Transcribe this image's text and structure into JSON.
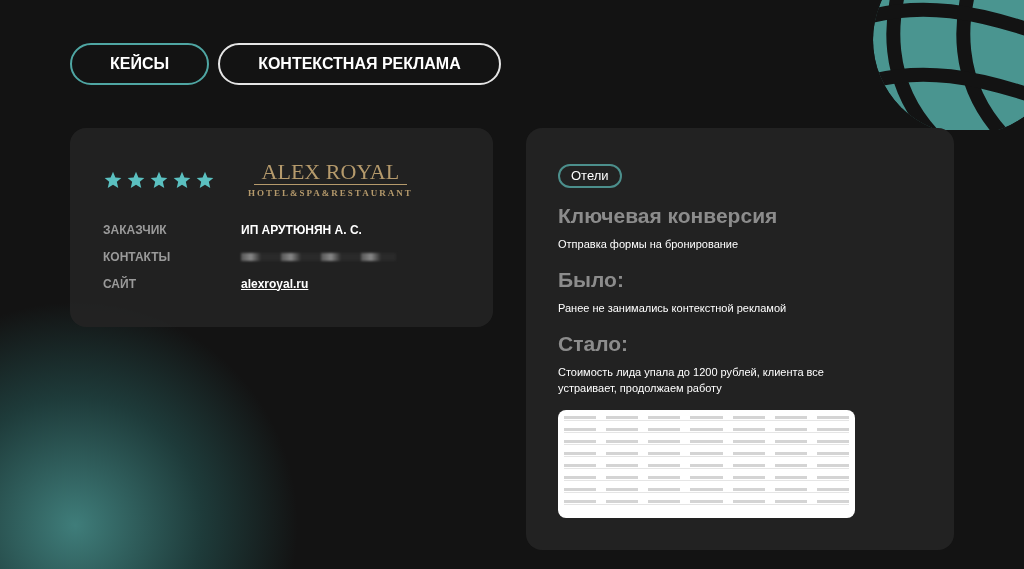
{
  "breadcrumbs": [
    {
      "label": "КЕЙСЫ",
      "selected": true
    },
    {
      "label": "КОНТЕКСТНАЯ РЕКЛАМА",
      "selected": false
    }
  ],
  "client_card": {
    "stars": 5,
    "logo": {
      "title": "ALEX ROYAL",
      "subtitle": "HOTEL&SPA&RESTAURANT"
    },
    "fields": [
      {
        "label": "ЗАКАЗЧИК",
        "kind": "text",
        "value": "ИП АРУТЮНЯН А. С."
      },
      {
        "label": "КОНТАКТЫ",
        "kind": "hidden"
      },
      {
        "label": "САЙТ",
        "kind": "link",
        "value": "alexroyal.ru"
      }
    ]
  },
  "case_card": {
    "tag": "Отели",
    "sections": [
      {
        "heading": "Ключевая конверсия",
        "text": "Отправка формы на бронирование"
      },
      {
        "heading": "Было:",
        "text": "Ранее не занимались контекстной рекламой"
      },
      {
        "heading": "Стало:",
        "text": "Стоимость лида упала до 1200 рублей, клиента все устраивает, продолжаем работу"
      }
    ]
  }
}
